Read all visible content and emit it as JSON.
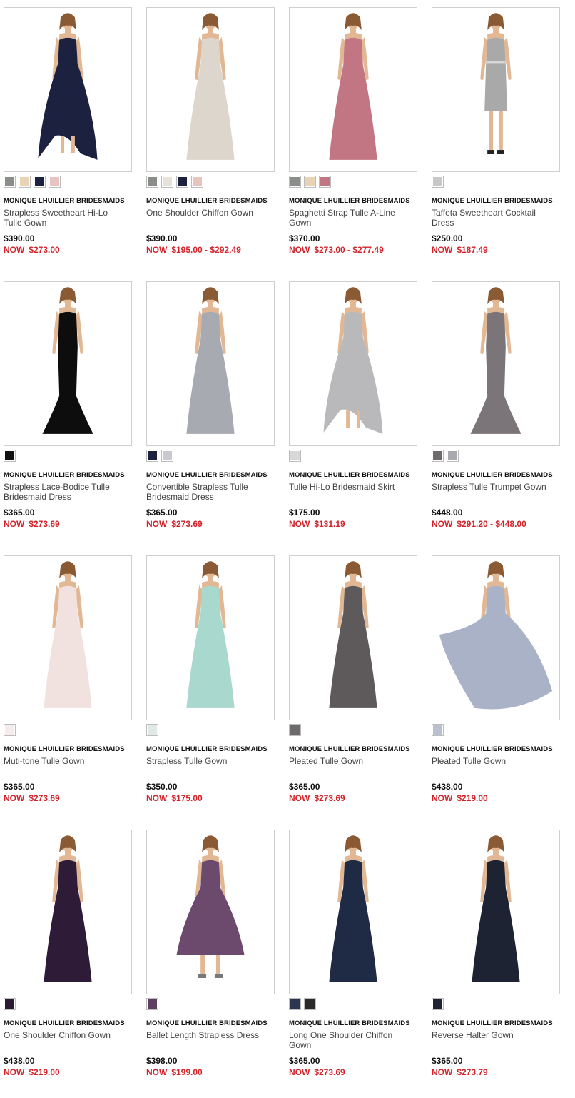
{
  "products": [
    {
      "brand": "MONIQUE LHUILLIER BRIDESMAIDS",
      "name": "Strapless Sweetheart Hi-Lo Tulle Gown",
      "price": "$390.00",
      "sale_label": "NOW",
      "sale": "$273.00",
      "dress_color": "#1d2140",
      "swatches": [
        "#8a8d8a",
        "#e8d4b4",
        "#1d2140",
        "#e8c4c0"
      ],
      "dress": "gown-hilo"
    },
    {
      "brand": "MONIQUE LHUILLIER BRIDESMAIDS",
      "name": "One Shoulder Chiffon Gown",
      "price": "$390.00",
      "sale_label": "NOW",
      "sale": "$195.00 - $292.49",
      "dress_color": "#ddd6cc",
      "swatches": [
        "#8a8d8a",
        "#e6e2da",
        "#1d2140",
        "#e8c4c0"
      ],
      "dress": "gown"
    },
    {
      "brand": "MONIQUE LHUILLIER BRIDESMAIDS",
      "name": "Spaghetti Strap Tulle A-Line Gown",
      "price": "$370.00",
      "sale_label": "NOW",
      "sale": "$273.00 - $277.49",
      "dress_color": "#c27582",
      "swatches": [
        "#8a8d8a",
        "#e8d4b4",
        "#c27582"
      ],
      "dress": "gown"
    },
    {
      "brand": "MONIQUE LHUILLIER BRIDESMAIDS",
      "name": "Taffeta Sweetheart Cocktail Dress",
      "price": "$250.00",
      "sale_label": "NOW",
      "sale": "$187.49",
      "dress_color": "#a9a9a9",
      "swatches": [
        "#c8c8c8"
      ],
      "dress": "cocktail"
    },
    {
      "brand": "MONIQUE LHUILLIER BRIDESMAIDS",
      "name": "Strapless Lace-Bodice Tulle Bridesmaid Dress",
      "price": "$365.00",
      "sale_label": "NOW",
      "sale": "$273.69",
      "dress_color": "#0d0d0d",
      "swatches": [
        "#111111"
      ],
      "dress": "mermaid"
    },
    {
      "brand": "MONIQUE LHUILLIER BRIDESMAIDS",
      "name": "Convertible Strapless Tulle Bridesmaid Dress",
      "price": "$365.00",
      "sale_label": "NOW",
      "sale": "$273.69",
      "dress_color": "#a7aab0",
      "swatches": [
        "#1d2140",
        "#c8cacf"
      ],
      "dress": "gown"
    },
    {
      "brand": "MONIQUE LHUILLIER BRIDESMAIDS",
      "name": "Tulle Hi-Lo Bridesmaid Skirt",
      "price": "$175.00",
      "sale_label": "NOW",
      "sale": "$131.19",
      "dress_color": "#b9b9bb",
      "swatches": [
        "#d8d8d8"
      ],
      "dress": "hilo"
    },
    {
      "brand": "MONIQUE LHUILLIER BRIDESMAIDS",
      "name": "Strapless Tulle Trumpet Gown",
      "price": "$448.00",
      "sale_label": "NOW",
      "sale": "$291.20 - $448.00",
      "dress_color": "#7b7478",
      "swatches": [
        "#6f6a6e",
        "#a9aaad"
      ],
      "dress": "mermaid"
    },
    {
      "brand": "MONIQUE LHUILLIER BRIDESMAIDS",
      "name": "Muti-tone Tulle Gown",
      "price": "$365.00",
      "sale_label": "NOW",
      "sale": "$273.69",
      "dress_color": "#f1e2df",
      "swatches": [
        "#f6ecec"
      ],
      "dress": "gown"
    },
    {
      "brand": "MONIQUE LHUILLIER BRIDESMAIDS",
      "name": "Strapless Tulle Gown",
      "price": "$350.00",
      "sale_label": "NOW",
      "sale": "$175.00",
      "dress_color": "#a9d8cf",
      "swatches": [
        "#dfe9e6"
      ],
      "dress": "gown"
    },
    {
      "brand": "MONIQUE LHUILLIER BRIDESMAIDS",
      "name": "Pleated Tulle Gown",
      "price": "$365.00",
      "sale_label": "NOW",
      "sale": "$273.69",
      "dress_color": "#5e5a5b",
      "swatches": [
        "#6d6a6c"
      ],
      "dress": "gown"
    },
    {
      "brand": "MONIQUE LHUILLIER BRIDESMAIDS",
      "name": "Pleated Tulle Gown",
      "price": "$438.00",
      "sale_label": "NOW",
      "sale": "$219.00",
      "dress_color": "#a9b2c7",
      "swatches": [
        "#b9c0d1"
      ],
      "dress": "flowing"
    },
    {
      "brand": "MONIQUE LHUILLIER BRIDESMAIDS",
      "name": "One Shoulder Chiffon Gown",
      "price": "$438.00",
      "sale_label": "NOW",
      "sale": "$219.00",
      "dress_color": "#2d1b38",
      "swatches": [
        "#2a1a33"
      ],
      "dress": "gown"
    },
    {
      "brand": "MONIQUE LHUILLIER BRIDESMAIDS",
      "name": "Ballet Length Strapless Dress",
      "price": "$398.00",
      "sale_label": "NOW",
      "sale": "$199.00",
      "dress_color": "#6c4a6e",
      "swatches": [
        "#5e3f63"
      ],
      "dress": "ballet"
    },
    {
      "brand": "MONIQUE LHUILLIER BRIDESMAIDS",
      "name": "Long One Shoulder Chiffon Gown",
      "price": "$365.00",
      "sale_label": "NOW",
      "sale": "$273.69",
      "dress_color": "#1f2a45",
      "swatches": [
        "#2b3550",
        "#2a2a2a"
      ],
      "dress": "gown"
    },
    {
      "brand": "MONIQUE LHUILLIER BRIDESMAIDS",
      "name": "Reverse Halter Gown",
      "price": "$365.00",
      "sale_label": "NOW",
      "sale": "$273.79",
      "dress_color": "#1e2333",
      "swatches": [
        "#1f2433"
      ],
      "dress": "gown"
    }
  ]
}
